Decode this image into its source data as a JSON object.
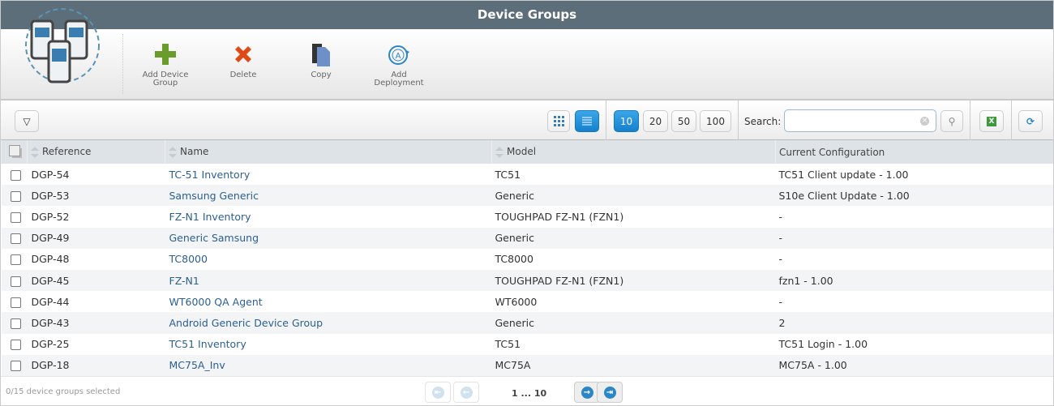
{
  "title": "Device Groups",
  "toolbar": {
    "add": "Add Device Group",
    "delete": "Delete",
    "copy": "Copy",
    "deploy": "Add Deployment"
  },
  "page_sizes": [
    "10",
    "20",
    "50",
    "100"
  ],
  "search": {
    "label": "Search:",
    "value": "",
    "placeholder": ""
  },
  "columns": [
    "Reference",
    "Name",
    "Model",
    "Current Configuration"
  ],
  "rows": [
    {
      "ref": "DGP-54",
      "name": "TC-51 Inventory",
      "model": "TC51",
      "config": "TC51 Client update - 1.00"
    },
    {
      "ref": "DGP-53",
      "name": "Samsung Generic",
      "model": "Generic",
      "config": "S10e Client Update - 1.00"
    },
    {
      "ref": "DGP-52",
      "name": "FZ-N1 Inventory",
      "model": "TOUGHPAD FZ-N1 (FZN1)",
      "config": "-"
    },
    {
      "ref": "DGP-49",
      "name": "Generic Samsung",
      "model": "Generic",
      "config": "-"
    },
    {
      "ref": "DGP-48",
      "name": "TC8000",
      "model": "TC8000",
      "config": "-"
    },
    {
      "ref": "DGP-45",
      "name": "FZ-N1",
      "model": "TOUGHPAD FZ-N1 (FZN1)",
      "config": "fzn1 - 1.00"
    },
    {
      "ref": "DGP-44",
      "name": "WT6000 QA Agent",
      "model": "WT6000",
      "config": "-"
    },
    {
      "ref": "DGP-43",
      "name": "Android Generic Device Group",
      "model": "Generic",
      "config": "2"
    },
    {
      "ref": "DGP-25",
      "name": "TC51 Inventory",
      "model": "TC51",
      "config": "TC51 Login - 1.00"
    },
    {
      "ref": "DGP-18",
      "name": "MC75A_Inv",
      "model": "MC75A",
      "config": "MC75A - 1.00"
    }
  ],
  "footer": {
    "selected": "0/15 device groups selected",
    "pages": "1 ... 10"
  }
}
